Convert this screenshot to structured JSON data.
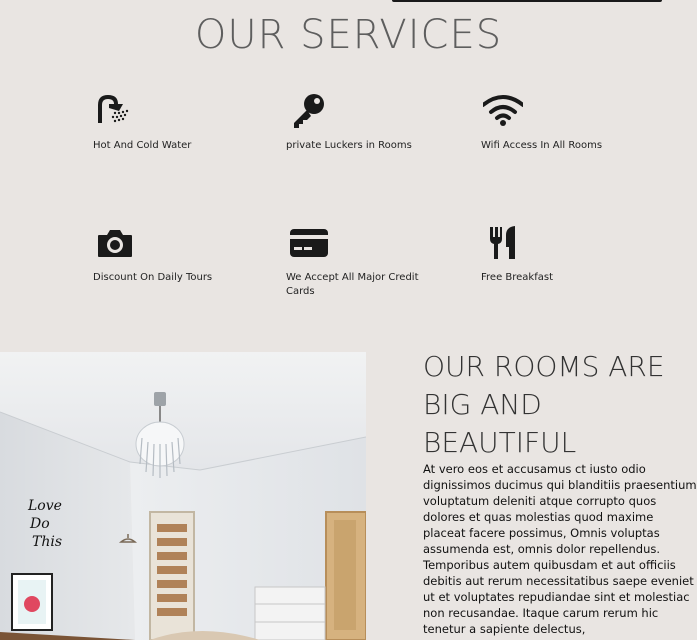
{
  "services": {
    "title": "OUR SERVICES",
    "items": [
      {
        "label": "Hot And Cold Water",
        "icon": "shower-icon"
      },
      {
        "label": "private Luckers in Rooms",
        "icon": "key-icon"
      },
      {
        "label": "Wifi Access In All Rooms",
        "icon": "wifi-icon"
      },
      {
        "label": "Discount On Daily Tours",
        "icon": "camera-icon"
      },
      {
        "label": "We Accept All Major Credit Cards",
        "icon": "credit-card-icon"
      },
      {
        "label": "Free Breakfast",
        "icon": "utensils-icon"
      }
    ]
  },
  "rooms": {
    "title": "OUR ROOMS ARE BIG AND BEAUTIFUL",
    "text": "At vero eos et accusamus ct iusto odio dignissimos ducimus qui blanditiis praesentium voluptatum deleniti atque corrupto quos dolores et quas molestias quod maxime placeat facere possimus, Omnis voluptas assumenda est, omnis dolor repellendus. Temporibus autem quibusdam et aut officiis debitis aut rerum necessitatibus saepe eveniet ut et voluptates repudiandae sint et molestiac non recusandae. Itaque carum rerum hic tenetur a sapiente delectus,",
    "photo_poster_text": "Love Do This"
  }
}
